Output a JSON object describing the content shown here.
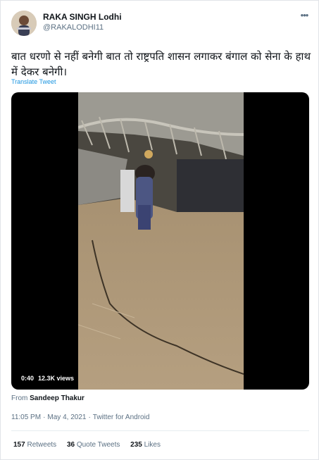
{
  "author": {
    "name": "RAKA SINGH Lodhi",
    "handle": "@RAKALODHI11"
  },
  "more_icon": "more-horizontal-icon",
  "tweet_text": "बात धरणो से नहीं बनेगी बात तो राष्ट्रपति शासन लगाकर बंगाल को सेना के हाथ में देकर बनेगी।",
  "translate_label": "Translate Tweet",
  "media": {
    "duration": "0:40",
    "views": "12.3K views"
  },
  "source": {
    "prefix": "From",
    "name": "Sandeep Thakur"
  },
  "meta": {
    "time": "11:05 PM",
    "separator": "·",
    "date": "May 4, 2021",
    "client": "Twitter for Android"
  },
  "stats": {
    "retweets_count": "157",
    "retweets_label": "Retweets",
    "quote_count": "36",
    "quote_label": "Quote Tweets",
    "likes_count": "235",
    "likes_label": "Likes"
  }
}
